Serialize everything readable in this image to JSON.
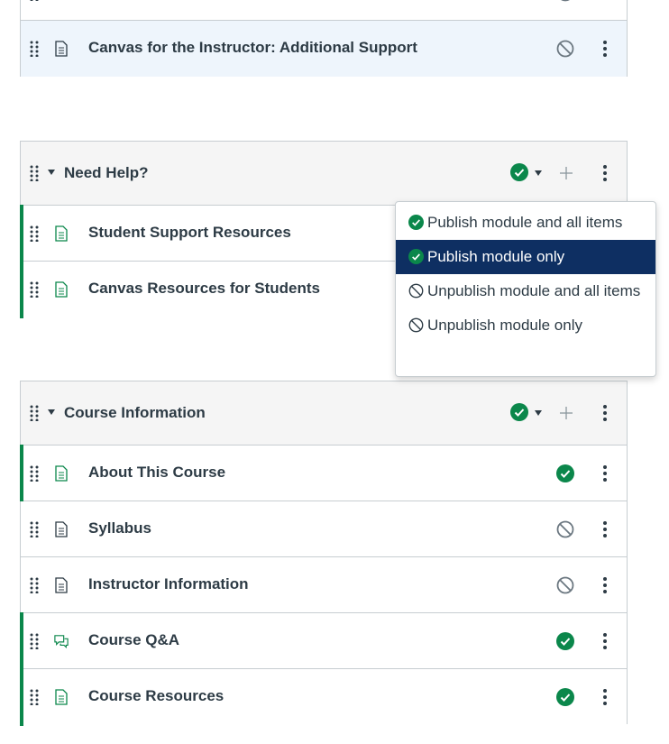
{
  "top_module": {
    "items": [
      {
        "title": "Canvas for the Instructor: Additional Support",
        "published": false,
        "icon": "page-icon"
      }
    ]
  },
  "need_help": {
    "title": "Need Help?",
    "status": "published",
    "items": [
      {
        "title": "Student Support Resources",
        "published": true,
        "icon": "page-icon"
      },
      {
        "title": "Canvas Resources for Students",
        "published": true,
        "icon": "page-icon"
      }
    ]
  },
  "publish_menu": {
    "items": [
      {
        "label": "Publish module and all items",
        "icon": "published-check-icon"
      },
      {
        "label": "Publish module only",
        "icon": "published-check-icon",
        "selected": true
      },
      {
        "label": "Unpublish module and all items",
        "icon": "unpublished-icon"
      },
      {
        "label": "Unpublish module only",
        "icon": "unpublished-icon"
      }
    ]
  },
  "course_info": {
    "title": "Course Information",
    "status": "published",
    "items": [
      {
        "title": "About This Course",
        "published": true,
        "icon": "page-icon"
      },
      {
        "title": "Syllabus",
        "published": false,
        "icon": "page-icon"
      },
      {
        "title": "Instructor Information",
        "published": false,
        "icon": "page-icon"
      },
      {
        "title": "Course Q&A",
        "published": true,
        "icon": "discussion-icon"
      },
      {
        "title": "Course Resources",
        "published": true,
        "icon": "page-icon"
      }
    ]
  },
  "colors": {
    "published_green": "#0b874b",
    "menu_selected_bg": "#0e2f62",
    "unpublished_gray": "#6b7780",
    "highlight_row": "#eef5fc"
  }
}
